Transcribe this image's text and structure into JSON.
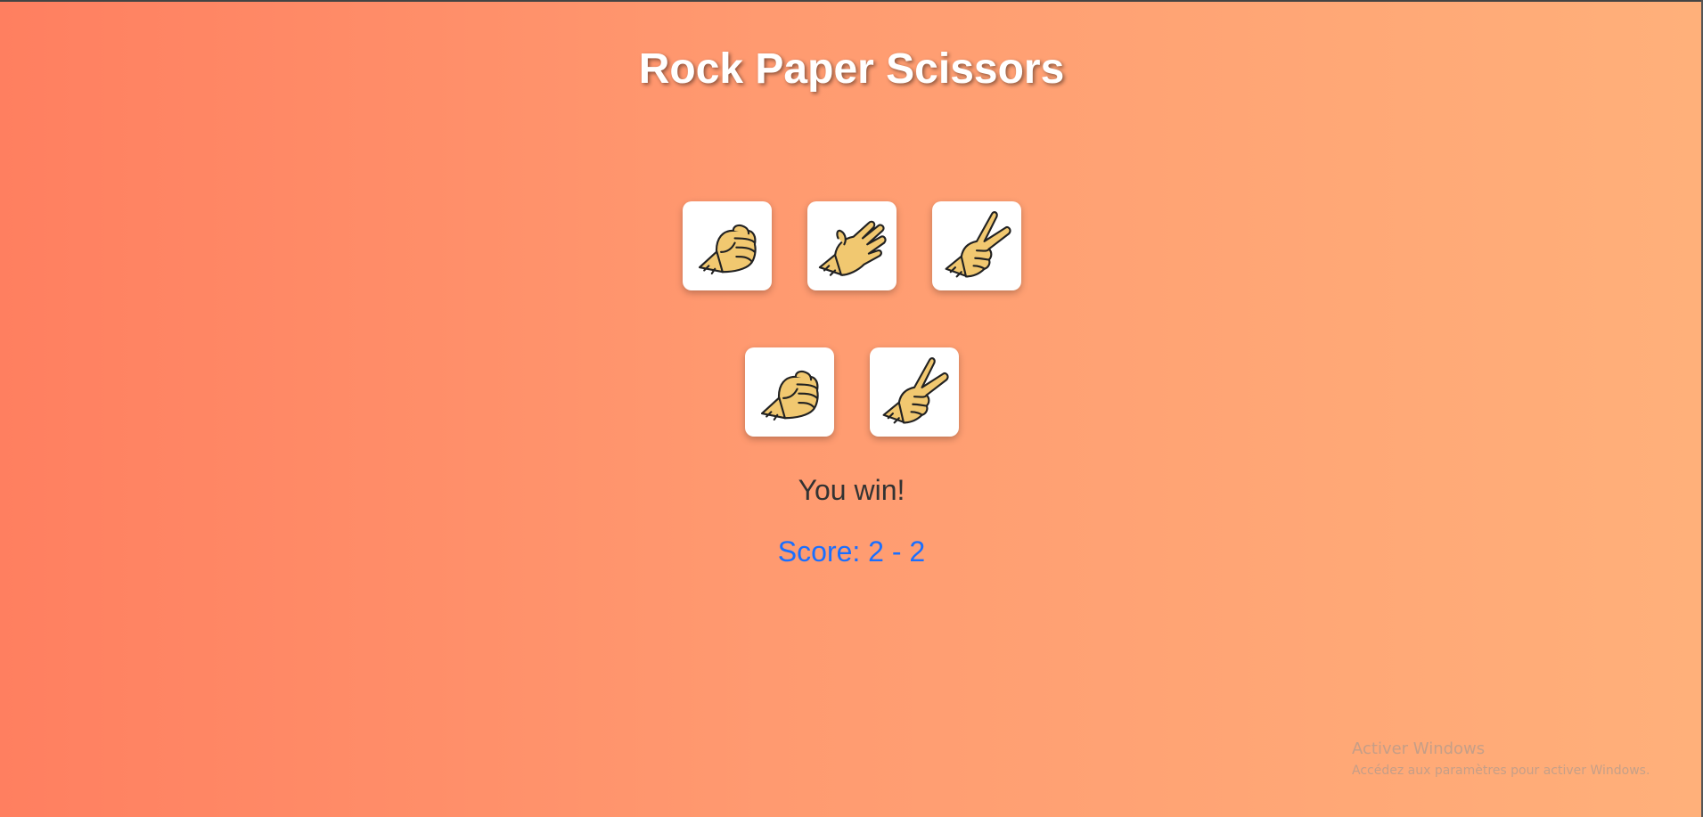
{
  "title": "Rock Paper Scissors",
  "choices": [
    {
      "name": "rock",
      "icon": "rock-hand-icon"
    },
    {
      "name": "paper",
      "icon": "paper-hand-icon"
    },
    {
      "name": "scissors",
      "icon": "scissors-hand-icon"
    }
  ],
  "result": {
    "player": {
      "icon": "rock-hand-icon"
    },
    "computer": {
      "icon": "scissors-hand-icon"
    }
  },
  "message": "You win!",
  "score": {
    "label": "Score: 2 - 2",
    "color": "#1a6fff"
  },
  "watermark": {
    "line1": "Activer Windows",
    "line2": "Accédez aux paramètres pour activer Windows."
  },
  "colors": {
    "gradient_left": "#ff7f60",
    "gradient_right": "#ffb07a",
    "hand_skin": "#f1c870",
    "title": "#ffffff",
    "message": "#333333"
  }
}
